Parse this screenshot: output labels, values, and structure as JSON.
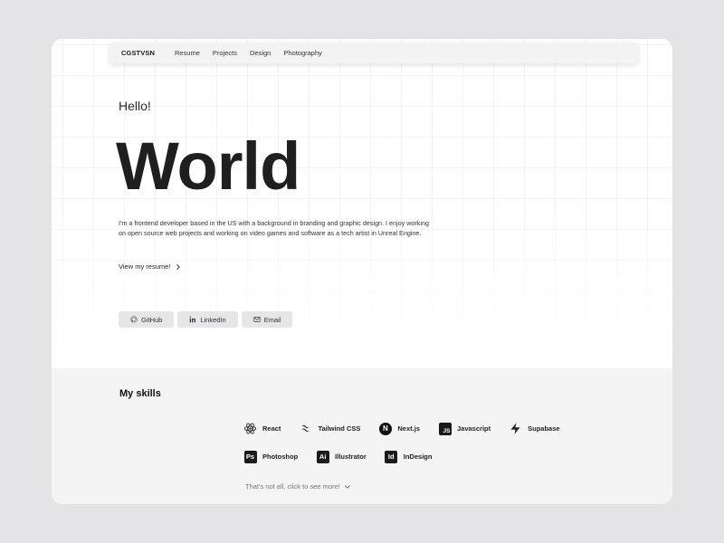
{
  "nav": {
    "brand": "CGSTVSN",
    "links": [
      "Resume",
      "Projects",
      "Design",
      "Photography"
    ]
  },
  "hero": {
    "greeting": "Hello!",
    "headline": "World",
    "bio": "I'm a frontend developer based in the US with a background in branding and graphic design. I enjoy working on open source web projects and working on video games and software as a tech artist in Unreal Engine.",
    "resume_link": "View my resume!"
  },
  "socials": [
    {
      "label": "GitHub",
      "icon": "github-icon"
    },
    {
      "label": "LinkedIn",
      "icon": "linkedin-icon"
    },
    {
      "label": "Email",
      "icon": "email-icon"
    }
  ],
  "skills": {
    "title": "My skills",
    "row1": [
      {
        "label": "React",
        "icon": "react-icon"
      },
      {
        "label": "Tailwind CSS",
        "icon": "tailwind-icon"
      },
      {
        "label": "Next.js",
        "icon": "nextjs-icon",
        "glyph": "N"
      },
      {
        "label": "Javascript",
        "icon": "javascript-icon",
        "glyph": "JS"
      },
      {
        "label": "Supabase",
        "icon": "supabase-icon"
      }
    ],
    "row2": [
      {
        "label": "Photoshop",
        "icon": "photoshop-icon",
        "glyph": "Ps"
      },
      {
        "label": "Illustrator",
        "icon": "illustrator-icon",
        "glyph": "Ai"
      },
      {
        "label": "InDesign",
        "icon": "indesign-icon",
        "glyph": "Id"
      }
    ],
    "more": "That's not all, click to see more!"
  },
  "colors": {
    "page_bg": "#e4e4e6",
    "card_bg": "#ffffff",
    "skills_bg": "#f4f4f5",
    "button_bg": "#e6e6e8",
    "icon_dark": "#1b1b1b"
  }
}
